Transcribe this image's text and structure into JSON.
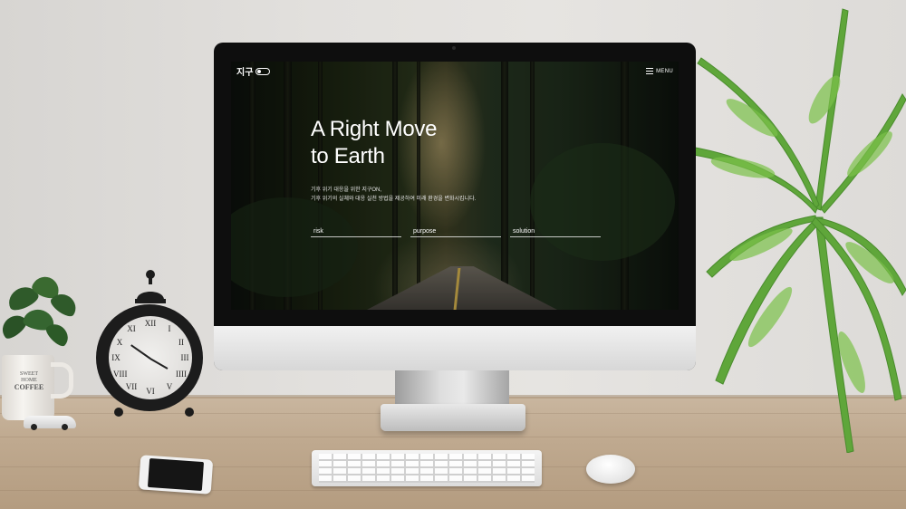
{
  "site": {
    "logo_text": "지구",
    "menu_label": "MENU",
    "headline_line1": "A Right Move",
    "headline_line2": "to Earth",
    "desc_line1": "기후 위기 대응을 위한 지구ON,",
    "desc_line2": "기후 위기의 실체와 대응 실천 방법을 제공하여 미래 환경을 변화시킵니다.",
    "nav": [
      "risk",
      "purpose",
      "solution"
    ]
  },
  "props": {
    "mug_text_line1": "SWEET HOME",
    "mug_text_line2": "COFFEE",
    "clock_numerals": [
      "XII",
      "I",
      "II",
      "III",
      "IIII",
      "V",
      "VI",
      "VII",
      "VIII",
      "IX",
      "X",
      "XI"
    ]
  },
  "colors": {
    "screen_text": "#ffffff",
    "road_line": "#c8a84a",
    "fern": "#5fa63a"
  }
}
